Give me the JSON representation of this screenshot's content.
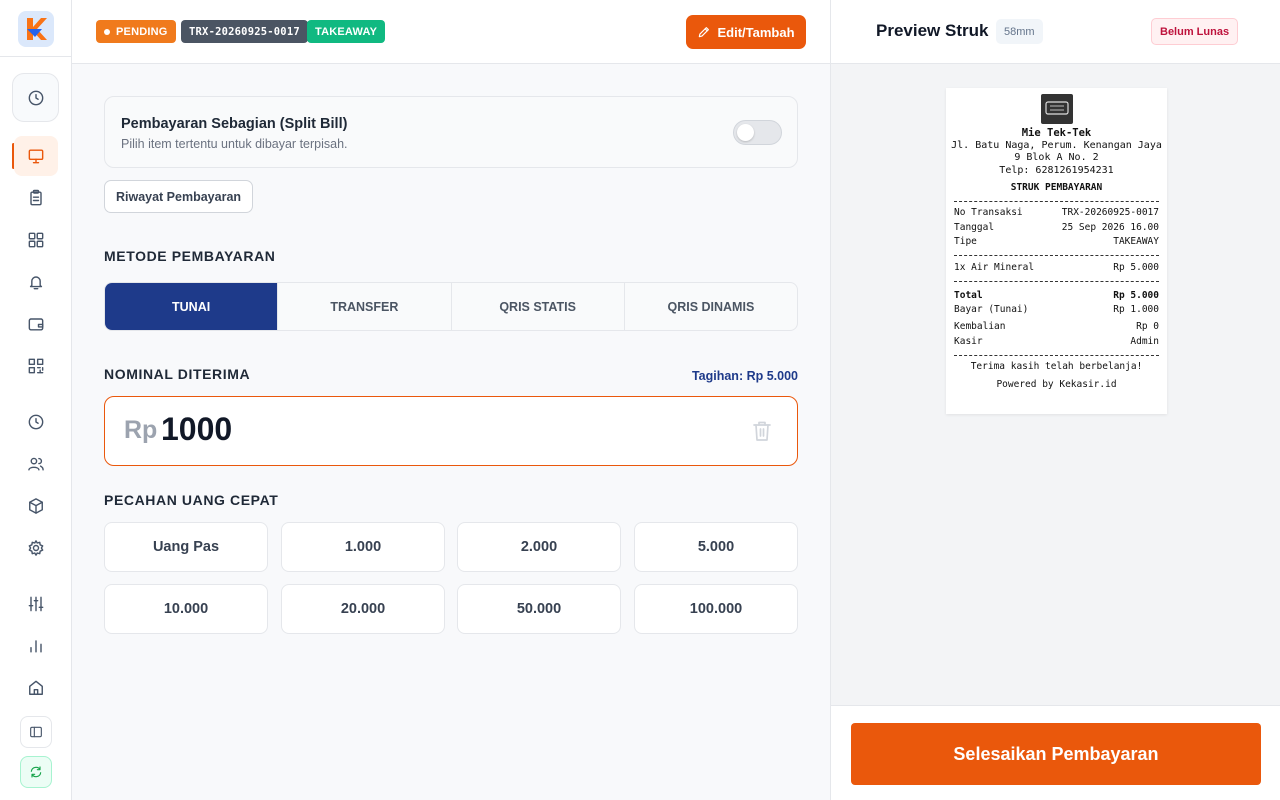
{
  "header": {
    "status": "PENDING",
    "transaction_id": "TRX-20260925-0017",
    "order_type": "TAKEAWAY",
    "edit_label": "Edit/Tambah"
  },
  "split_bill": {
    "title": "Pembayaran Sebagian (Split Bill)",
    "subtitle": "Pilih item tertentu untuk dibayar terpisah.",
    "enabled": false
  },
  "history_label": "Riwayat Pembayaran",
  "payment_method": {
    "title": "METODE PEMBAYARAN",
    "selected": "TUNAI",
    "options": [
      "TUNAI",
      "TRANSFER",
      "QRIS STATIS",
      "QRIS DINAMIS"
    ]
  },
  "amount": {
    "title": "NOMINAL DITERIMA",
    "bill": "Tagihan: Rp 5.000",
    "prefix": "Rp",
    "value": "1000"
  },
  "quick_cash": {
    "title": "PECAHAN UANG CEPAT",
    "options": [
      "Uang Pas",
      "1.000",
      "2.000",
      "5.000",
      "10.000",
      "20.000",
      "50.000",
      "100.000"
    ]
  },
  "preview": {
    "title": "Preview Struk",
    "paper_size": "58mm",
    "payment_status": "Belum Lunas"
  },
  "receipt": {
    "store_name": "Mie Tek-Tek",
    "address_line1": "Jl. Batu Naga, Perum. Kenangan Jaya",
    "address_line2": "9 Blok A No. 2",
    "phone": "Telp: 6281261954231",
    "heading": "STRUK PEMBAYARAN",
    "info": [
      {
        "label": "No Transaksi",
        "value": "TRX-20260925-0017"
      },
      {
        "label": "Tanggal",
        "value": "25 Sep 2026 16.00"
      },
      {
        "label": "Tipe",
        "value": "TAKEAWAY"
      }
    ],
    "items": [
      {
        "label": "1x Air Mineral",
        "value": "Rp 5.000"
      }
    ],
    "total": {
      "label": "Total",
      "value": "Rp 5.000"
    },
    "paid": {
      "label": "Bayar (Tunai)",
      "value": "Rp 1.000"
    },
    "change": {
      "label": "Kembalian",
      "value": "Rp 0"
    },
    "cashier": {
      "label": "Kasir",
      "value": "Admin"
    },
    "footer_thanks": "Terima kasih telah berbelanja!",
    "footer_powered": "Powered by Kekasir.id"
  },
  "finish_label": "Selesaikan Pembayaran",
  "colors": {
    "accent": "#ea580c",
    "primary": "#1e3a8a",
    "success": "#10b981"
  }
}
